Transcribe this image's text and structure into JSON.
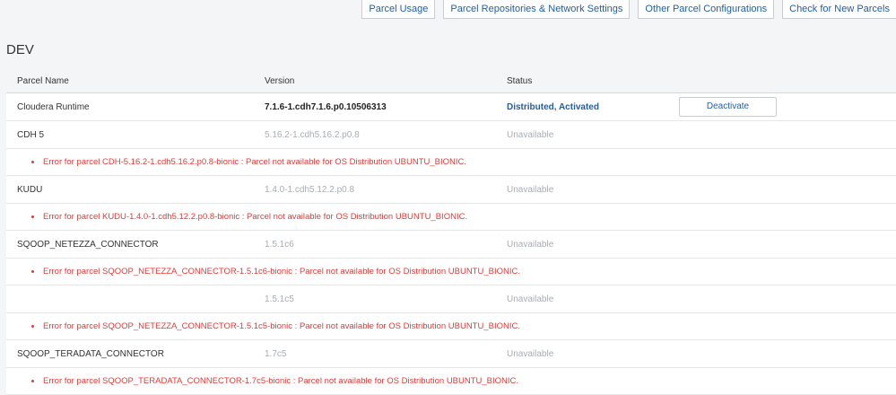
{
  "toolbar": {
    "buttons": [
      "Parcel Usage",
      "Parcel Repositories & Network Settings",
      "Other Parcel Configurations",
      "Check for New Parcels"
    ]
  },
  "section": {
    "title": "DEV"
  },
  "table": {
    "headers": [
      "Parcel Name",
      "Version",
      "Status"
    ],
    "rows": [
      {
        "name": "Cloudera Runtime",
        "version": "7.1.6-1.cdh7.1.6.p0.10506313",
        "status": "Distributed, Activated",
        "action": "Deactivate",
        "error": ""
      },
      {
        "name": "CDH 5",
        "version": "5.16.2-1.cdh5.16.2.p0.8",
        "status": "Unavailable",
        "action": "",
        "error": "Error for parcel CDH-5.16.2-1.cdh5.16.2.p0.8-bionic : Parcel not available for OS Distribution UBUNTU_BIONIC."
      },
      {
        "name": "KUDU",
        "version": "1.4.0-1.cdh5.12.2.p0.8",
        "status": "Unavailable",
        "action": "",
        "error": "Error for parcel KUDU-1.4.0-1.cdh5.12.2.p0.8-bionic : Parcel not available for OS Distribution UBUNTU_BIONIC."
      },
      {
        "name": "SQOOP_NETEZZA_CONNECTOR",
        "version": "1.5.1c6",
        "status": "Unavailable",
        "action": "",
        "error": "Error for parcel SQOOP_NETEZZA_CONNECTOR-1.5.1c6-bionic : Parcel not available for OS Distribution UBUNTU_BIONIC."
      },
      {
        "name": "",
        "version": "1.5.1c5",
        "status": "Unavailable",
        "action": "",
        "error": "Error for parcel SQOOP_NETEZZA_CONNECTOR-1.5.1c5-bionic : Parcel not available for OS Distribution UBUNTU_BIONIC."
      },
      {
        "name": "SQOOP_TERADATA_CONNECTOR",
        "version": "1.7c5",
        "status": "Unavailable",
        "action": "",
        "error": "Error for parcel SQOOP_TERADATA_CONNECTOR-1.7c5-bionic : Parcel not available for OS Distribution UBUNTU_BIONIC."
      }
    ]
  },
  "colors": {
    "link": "#1f5fa8",
    "error": "#e53935",
    "muted": "#a8adb2"
  }
}
